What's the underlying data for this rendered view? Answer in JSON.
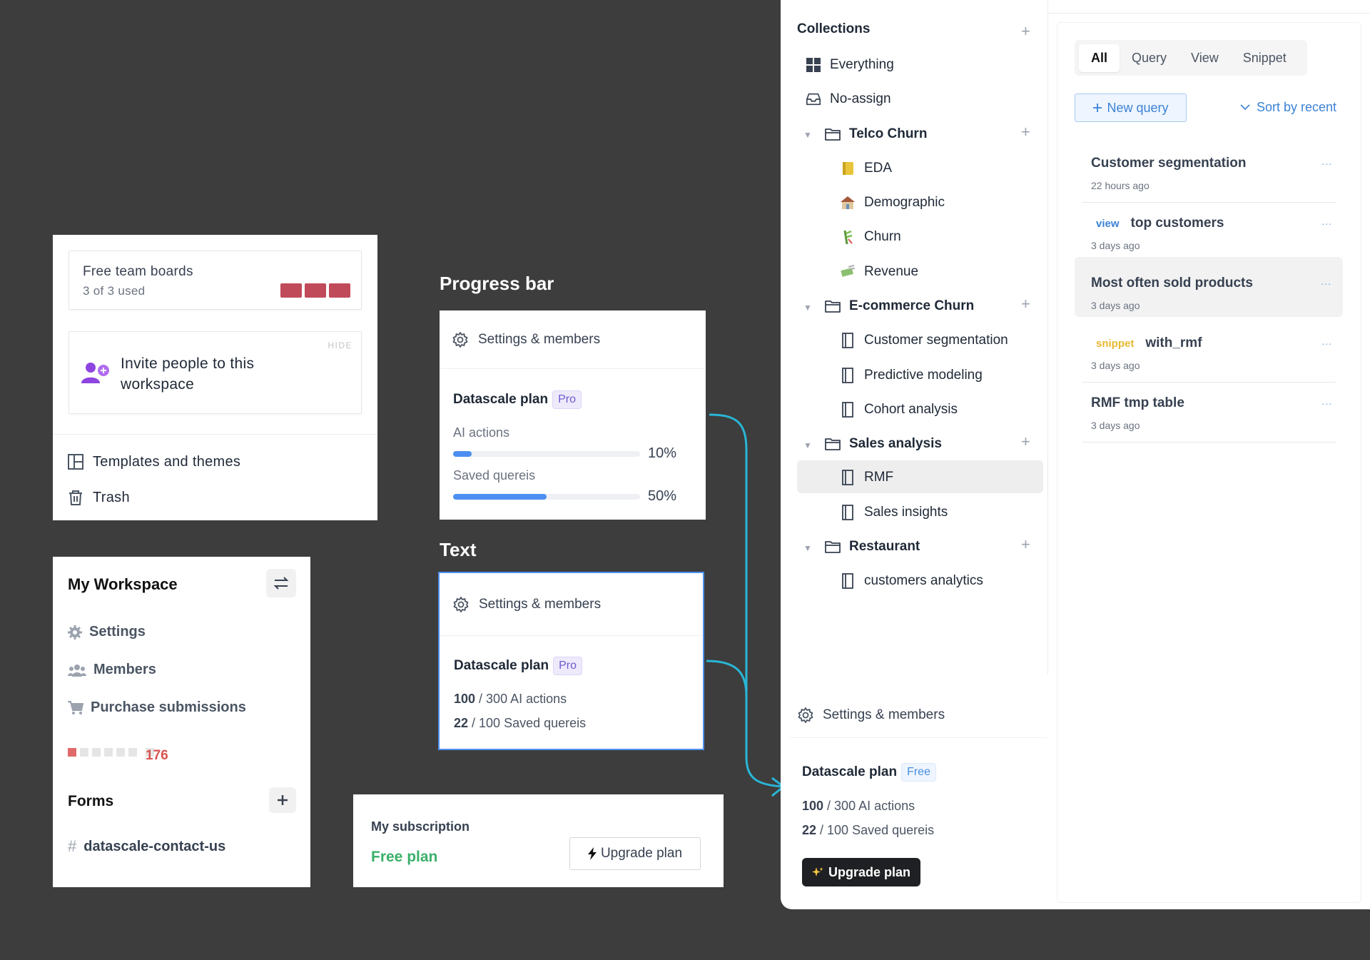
{
  "boards_card": {
    "title": "Free team boards",
    "usage": "3 of 3 used",
    "hide_label": "HIDE",
    "invite_text": "Invite people to this workspace",
    "templates_label": "Templates and themes",
    "trash_label": "Trash",
    "block_color": "#c04a5a"
  },
  "workspace": {
    "title": "My Workspace",
    "items": [
      "Settings",
      "Members",
      "Purchase submissions"
    ],
    "meter_filled": 1,
    "meter_total": 6,
    "count": "176",
    "forms_title": "Forms",
    "form_item": "datascale-contact-us"
  },
  "progress_section": {
    "title": "Progress bar",
    "header": "Settings & members",
    "plan": "Datascale plan",
    "badge": "Pro",
    "bars": [
      {
        "label": "AI actions",
        "percent": 10,
        "percent_text": "10%"
      },
      {
        "label": "Saved quereis",
        "percent": 50,
        "percent_text": "50%"
      }
    ]
  },
  "text_section": {
    "title": "Text",
    "header": "Settings & members",
    "plan": "Datascale plan",
    "badge": "Pro",
    "stat1_value": "100",
    "stat1_rest": " / 300 AI actions",
    "stat2_value": "22",
    "stat2_rest": " / 100 Saved quereis"
  },
  "subscription": {
    "title": "My subscription",
    "plan": "Free plan",
    "button": "Upgrade plan"
  },
  "collections": {
    "title": "Collections",
    "items": [
      {
        "label": "Everything",
        "icon": "grid-icon"
      },
      {
        "label": "No-assign",
        "icon": "inbox-icon"
      }
    ],
    "folders": [
      {
        "label": "Telco Churn",
        "children": [
          {
            "label": "EDA",
            "icon": "notebook-emoji-icon"
          },
          {
            "label": "Demographic",
            "icon": "house-emoji-icon"
          },
          {
            "label": "Churn",
            "icon": "bamboo-emoji-icon"
          },
          {
            "label": "Revenue",
            "icon": "money-emoji-icon"
          }
        ]
      },
      {
        "label": "E-commerce Churn",
        "children": [
          {
            "label": "Customer segmentation",
            "icon": "notebook-icon"
          },
          {
            "label": "Predictive modeling",
            "icon": "notebook-icon"
          },
          {
            "label": "Cohort analysis",
            "icon": "notebook-icon"
          }
        ]
      },
      {
        "label": "Sales analysis",
        "children": [
          {
            "label": "RMF",
            "icon": "notebook-icon"
          },
          {
            "label": "Sales insights",
            "icon": "notebook-icon"
          }
        ]
      },
      {
        "label": "Restaurant",
        "children": [
          {
            "label": "customers analytics",
            "icon": "notebook-icon"
          }
        ]
      }
    ]
  },
  "app_bottom": {
    "header": "Settings & members",
    "plan": "Datascale plan",
    "badge": "Free",
    "stat1_value": "100",
    "stat1_rest": " / 300 AI actions",
    "stat2_value": "22",
    "stat2_rest": " / 100 Saved quereis",
    "button": "Upgrade plan"
  },
  "queries_pane": {
    "tabs": [
      "All",
      "Query",
      "View",
      "Snippet"
    ],
    "active_tab": "All",
    "new_query": "New query",
    "sort": "Sort by recent",
    "items": [
      {
        "tag": "",
        "title": "Customer segmentation",
        "time": "22 hours ago"
      },
      {
        "tag": "view",
        "title": "top customers",
        "time": "3 days ago"
      },
      {
        "tag": "",
        "title": "Most often sold products",
        "time": "3 days ago"
      },
      {
        "tag": "snippet",
        "title": "with_rmf",
        "time": "3 days ago"
      },
      {
        "tag": "",
        "title": "RMF tmp table",
        "time": "3 days ago"
      }
    ],
    "more": "..."
  },
  "colors": {
    "accent": "#4d8ff0",
    "connector": "#29b6d6",
    "free_green": "#3ab06a",
    "danger": "#d9534f"
  }
}
